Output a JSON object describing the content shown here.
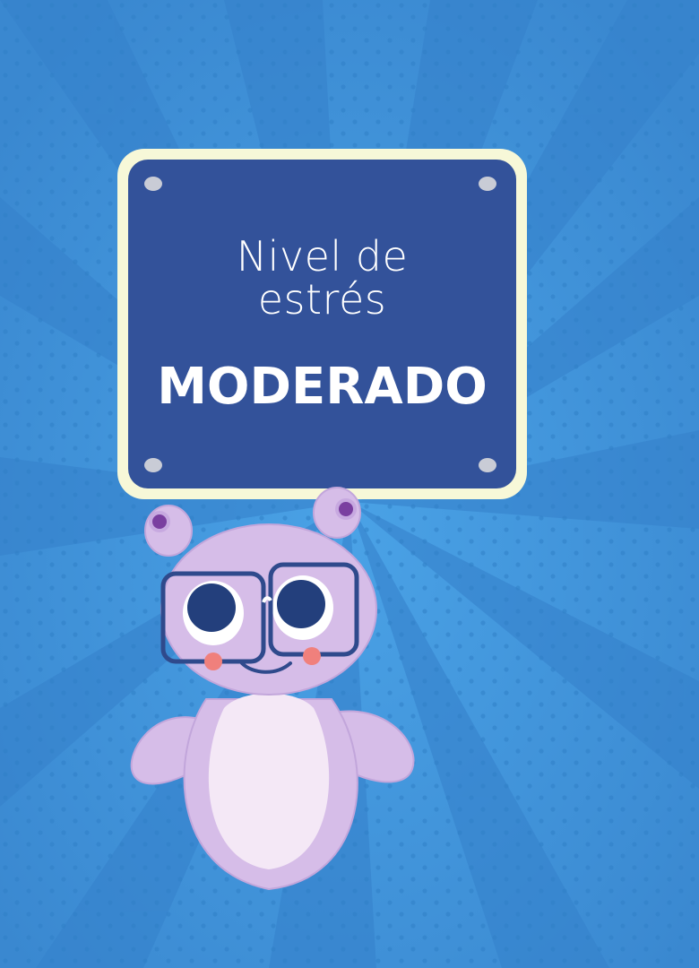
{
  "sign": {
    "label_line1": "Nivel de",
    "label_line2": "estrés",
    "level": "MODERADO"
  },
  "colors": {
    "background": "#3d8fd6",
    "sign_frame": "#f7f8d8",
    "sign_panel": "#33529a",
    "mascot_body": "#d6bde8",
    "mascot_belly": "#f4e8f6",
    "glasses_frame": "#2f4a8c",
    "eyes": "#233f7c",
    "cheeks": "#f0807c"
  },
  "icons": {
    "mascot": "purple-alien-with-glasses-icon",
    "background": "radial-burst-pattern"
  }
}
